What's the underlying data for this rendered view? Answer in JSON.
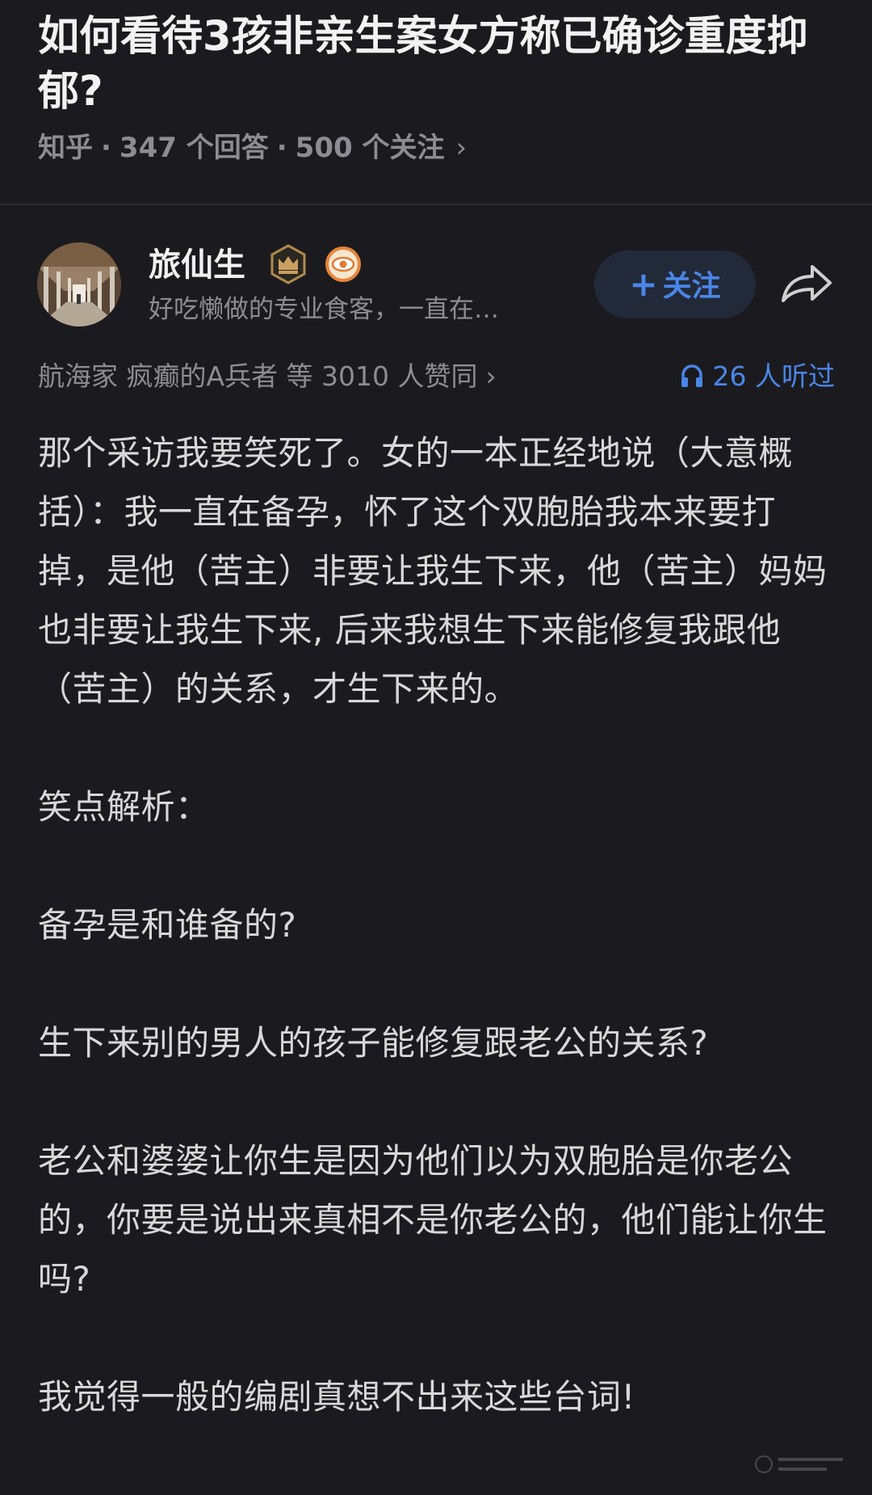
{
  "question": {
    "title": "如何看待3孩非亲生案女方称已确诊重度抑郁?",
    "source": "知乎",
    "answers": "347 个回答",
    "followers": "500 个关注",
    "chevron": "›"
  },
  "author": {
    "name": "旅仙生",
    "bio": "好吃懒做的专业食客，一直在…",
    "follow_label": "关注",
    "follow_plus": "+",
    "badges": [
      "crown-badge-icon",
      "eye-badge-icon"
    ],
    "share_icon": "share-icon"
  },
  "stats": {
    "voters_text": "航海家 疯癫的A兵者 等 3010 人赞同",
    "voters_chevron": "›",
    "listen_text": "26 人听过",
    "listen_icon": "headphone-icon"
  },
  "answer": {
    "paragraphs": [
      "那个采访我要笑死了。女的一本正经地说（大意概括）：我一直在备孕，怀了这个双胞胎我本来要打掉，是他（苦主）非要让我生下来，他（苦主）妈妈也非要让我生下来, 后来我想生下来能修复我跟他（苦主）的关系，才生下来的。",
      "笑点解析：",
      "备孕是和谁备的?",
      "生下来别的男人的孩子能修复跟老公的关系?",
      "老公和婆婆让你生是因为他们以为双胞胎是你老公的，你要是说出来真相不是你老公的，他们能让你生吗?",
      "我觉得一般的编剧真想不出来这些台词!"
    ]
  },
  "colors": {
    "background": "#1b1b1f",
    "accent": "#4a86e8",
    "muted": "#8c8c92",
    "text": "#d8d8d8"
  }
}
